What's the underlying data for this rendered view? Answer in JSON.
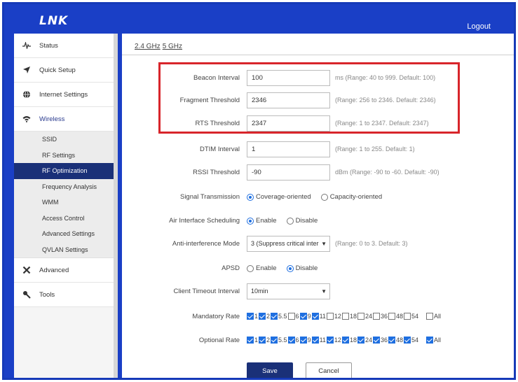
{
  "header": {
    "logo": "LNK",
    "logout": "Logout"
  },
  "sidebar": {
    "items": [
      {
        "label": "Status",
        "icon": "pulse-icon"
      },
      {
        "label": "Quick Setup",
        "icon": "plane-icon"
      },
      {
        "label": "Internet Settings",
        "icon": "globe-icon"
      },
      {
        "label": "Wireless",
        "icon": "wifi-icon"
      }
    ],
    "wireless_sub": [
      "SSID",
      "RF Settings",
      "RF Optimization",
      "Frequency Analysis",
      "WMM",
      "Access Control",
      "Advanced Settings",
      "QVLAN Settings"
    ],
    "items_after": [
      {
        "label": "Advanced",
        "icon": "tools-icon"
      },
      {
        "label": "Tools",
        "icon": "wrench-icon"
      }
    ]
  },
  "tabs": [
    "2.4 GHz",
    "5 GHz"
  ],
  "form": {
    "beacon": {
      "label": "Beacon Interval",
      "value": "100",
      "hint": "ms (Range: 40 to 999. Default: 100)"
    },
    "fragment": {
      "label": "Fragment Threshold",
      "value": "2346",
      "hint": "(Range: 256 to 2346. Default: 2346)"
    },
    "rts": {
      "label": "RTS Threshold",
      "value": "2347",
      "hint": "(Range: 1 to 2347. Default: 2347)"
    },
    "dtim": {
      "label": "DTIM Interval",
      "value": "1",
      "hint": "(Range: 1 to 255. Default: 1)"
    },
    "rssi": {
      "label": "RSSI Threshold",
      "value": "-90",
      "hint": "dBm (Range: -90 to -60. Default: -90)"
    },
    "signal": {
      "label": "Signal Transmission",
      "opt1": "Coverage-oriented",
      "opt2": "Capacity-oriented"
    },
    "airsched": {
      "label": "Air Interface Scheduling",
      "opt1": "Enable",
      "opt2": "Disable"
    },
    "antiint": {
      "label": "Anti-interference Mode",
      "value": "3 (Suppress critical inter",
      "hint": "(Range: 0 to 3. Default: 3)"
    },
    "apsd": {
      "label": "APSD",
      "opt1": "Enable",
      "opt2": "Disable"
    },
    "timeout": {
      "label": "Client Timeout Interval",
      "value": "10min"
    },
    "mandatory": {
      "label": "Mandatory Rate"
    },
    "optional": {
      "label": "Optional Rate"
    },
    "rates": [
      "1",
      "2",
      "5.5",
      "6",
      "9",
      "11",
      "12",
      "18",
      "24",
      "36",
      "48",
      "54"
    ],
    "all_label": "All"
  },
  "buttons": {
    "save": "Save",
    "cancel": "Cancel"
  },
  "colors": {
    "header": "#1a3fc6",
    "accent": "#1f6fe0",
    "active_nav": "#1a3078",
    "highlight": "#d8252b"
  }
}
